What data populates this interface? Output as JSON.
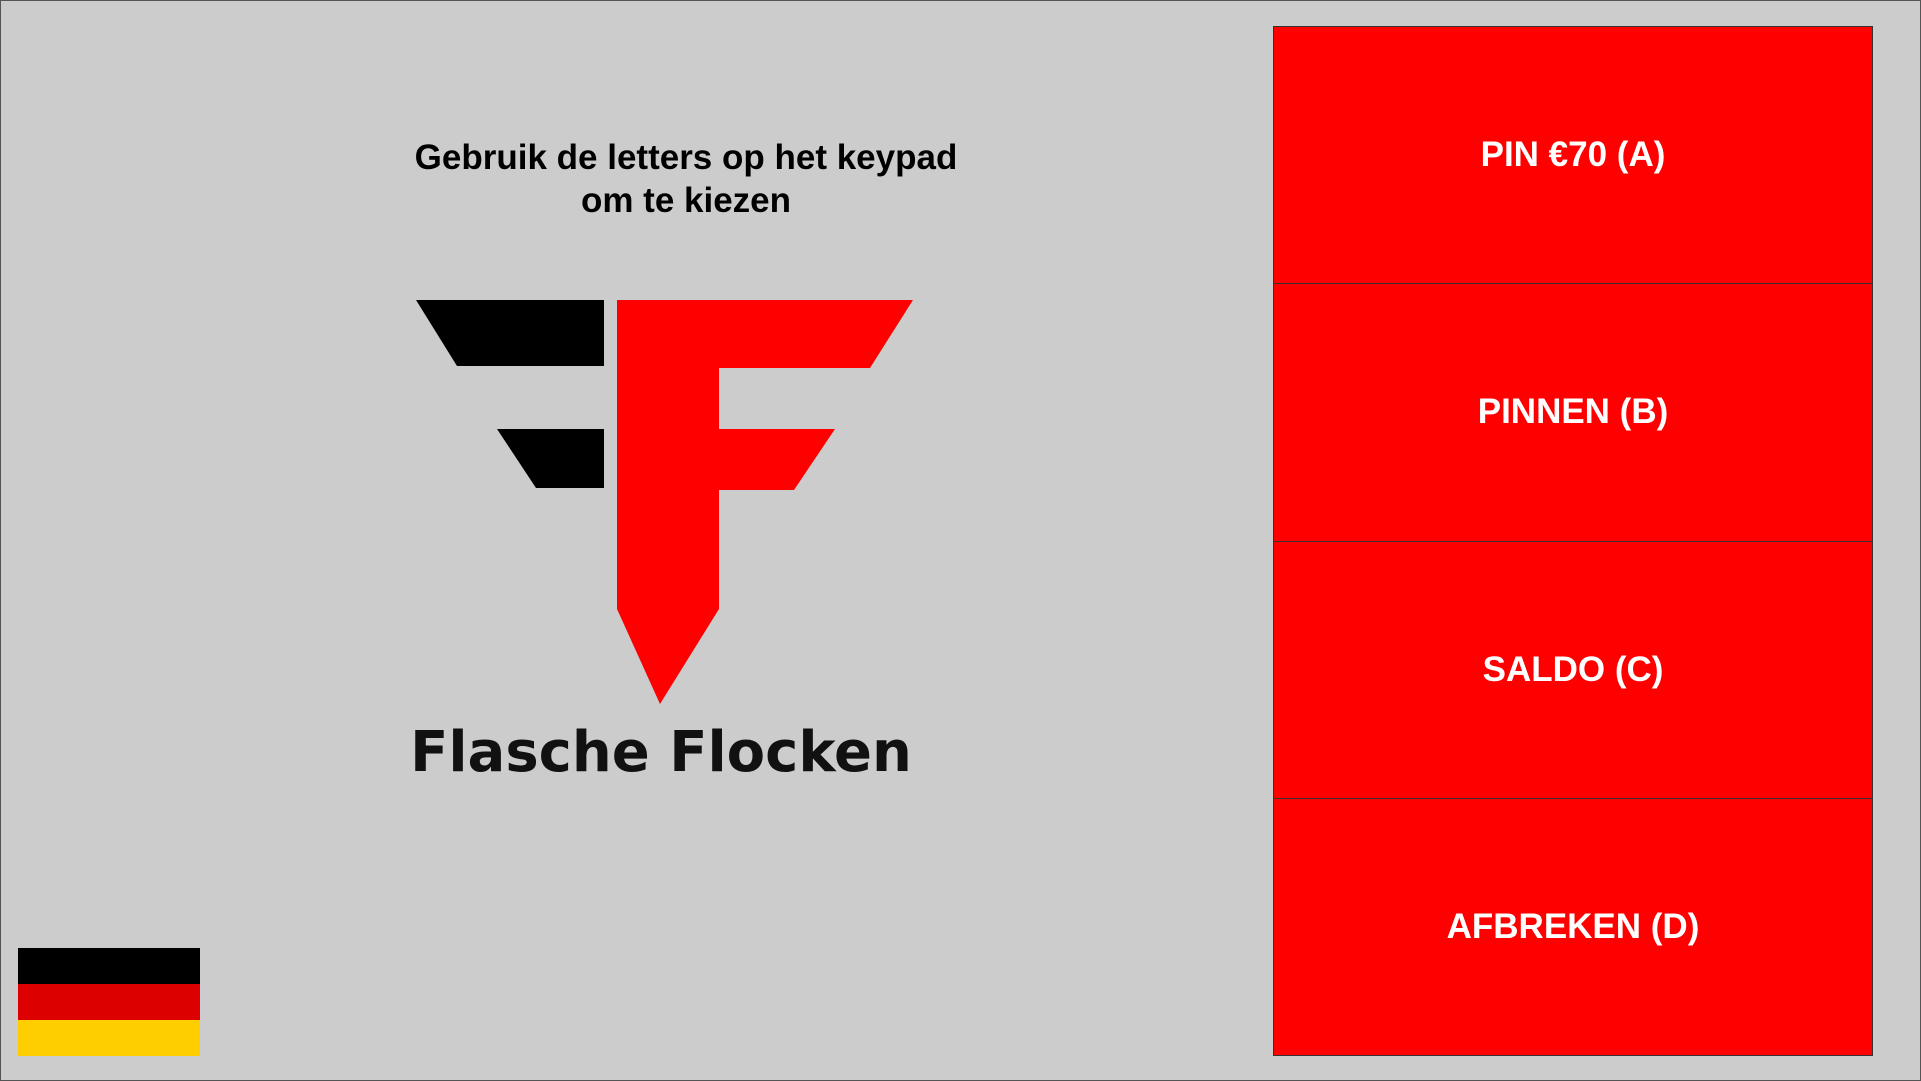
{
  "instruction": {
    "line1": "Gebruik de letters op het keypad",
    "line2": "om te kiezen"
  },
  "logo": {
    "brand_name": "Flasche Flocken",
    "colors": {
      "black": "#000000",
      "red": "#ff0000"
    }
  },
  "menu": {
    "items": [
      {
        "label": "PIN €70 (A)",
        "key": "A"
      },
      {
        "label": "PINNEN (B)",
        "key": "B"
      },
      {
        "label": "SALDO (C)",
        "key": "C"
      },
      {
        "label": "AFBREKEN (D)",
        "key": "D"
      }
    ],
    "button_color": "#ff0000",
    "text_color": "#ffffff"
  },
  "language_flag": {
    "icon": "german-flag-icon",
    "stripes": [
      "#000000",
      "#dd0000",
      "#ffce00"
    ]
  },
  "background_color": "#cccccc"
}
